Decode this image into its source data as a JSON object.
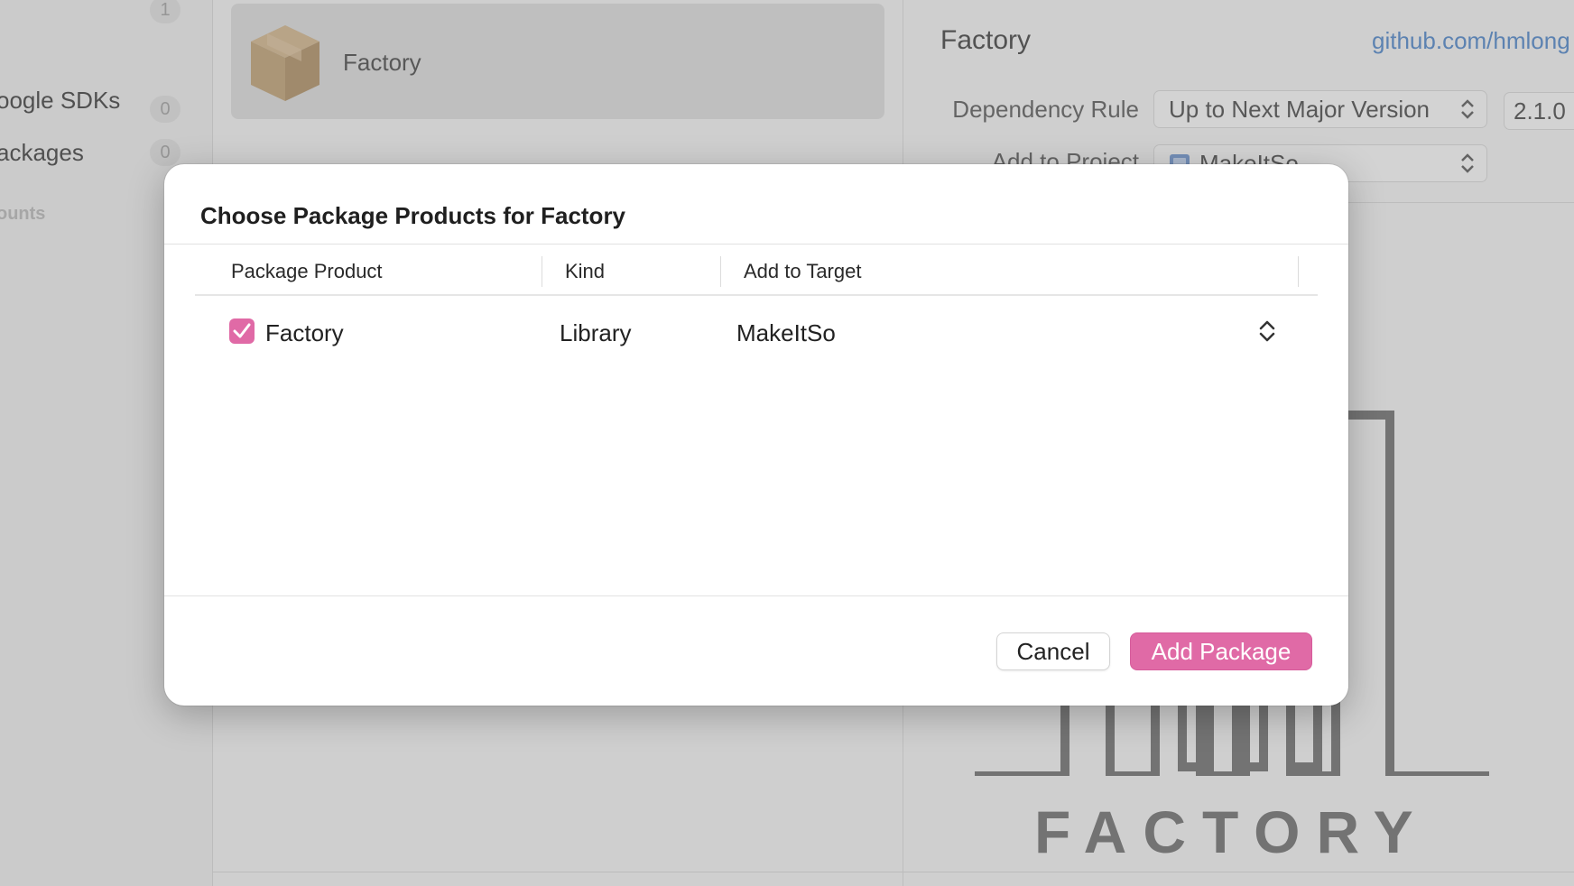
{
  "sidebar": {
    "items": [
      {
        "label": "",
        "count": "1"
      },
      {
        "label": "oogle SDKs",
        "count": "0"
      },
      {
        "label": "ackages",
        "count": "0"
      }
    ],
    "section_label": "ounts"
  },
  "middle": {
    "package_row": {
      "name": "Factory",
      "icon": "package-box-icon"
    }
  },
  "right": {
    "title": "Factory",
    "repo_link": "github.com/hmlong",
    "dependency_rule_label": "Dependency Rule",
    "dependency_rule_value": "Up to Next Major Version",
    "version_value": "2.1.0",
    "add_to_project_label": "Add to Project",
    "add_to_project_value": "MakeItSo",
    "logo_text": "FACTORY"
  },
  "modal": {
    "title": "Choose Package Products for Factory",
    "columns": {
      "product": "Package Product",
      "kind": "Kind",
      "target": "Add to Target"
    },
    "rows": [
      {
        "checked": true,
        "product": "Factory",
        "kind": "Library",
        "target": "MakeItSo"
      }
    ],
    "cancel_label": "Cancel",
    "add_label": "Add Package"
  },
  "colors": {
    "accent": "#e06aa6",
    "link": "#4a7fc0"
  }
}
